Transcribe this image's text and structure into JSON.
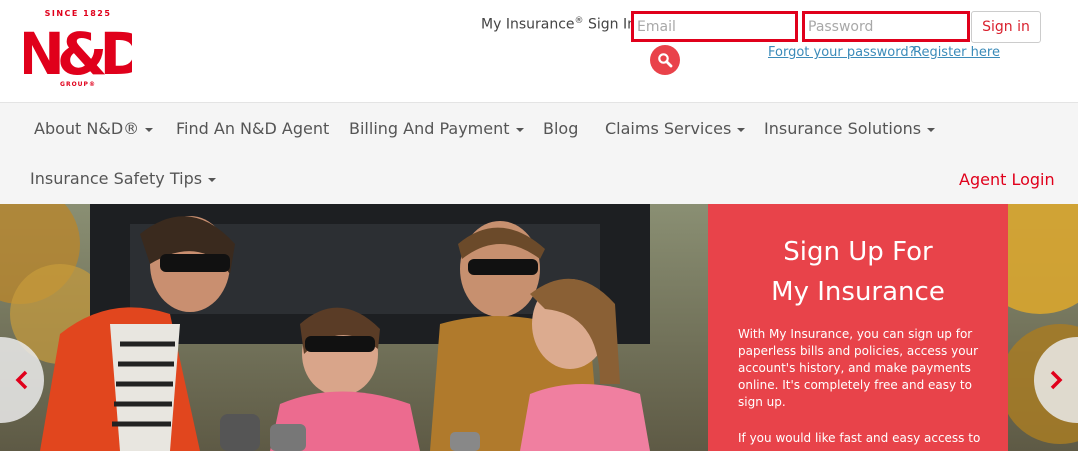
{
  "header": {
    "logo": {
      "tagline_top": "SINCE 1825",
      "monogram": "N&D",
      "tagline_bottom": "GROUP®"
    },
    "signin_label": "My Insurance",
    "signin_label_sup": "®",
    "signin_label_suffix": " Sign In:",
    "email_placeholder": "Email",
    "password_placeholder": "Password",
    "signin_button": "Sign in",
    "forgot_password": "Forgot your password?",
    "register": "Register here",
    "search_icon": "magnifier-icon"
  },
  "nav": {
    "items": [
      {
        "label": "About N&D®",
        "dropdown": true
      },
      {
        "label": "Find An N&D Agent",
        "dropdown": false
      },
      {
        "label": "Billing And Payment",
        "dropdown": true
      },
      {
        "label": "Blog",
        "dropdown": false
      },
      {
        "label": "Claims Services",
        "dropdown": true
      },
      {
        "label": "Insurance Solutions",
        "dropdown": true
      },
      {
        "label": "Insurance Safety Tips",
        "dropdown": true
      }
    ],
    "agent_login": "Agent Login"
  },
  "hero": {
    "promo_title_line1": "Sign Up For",
    "promo_title_line2": "My Insurance",
    "promo_body": "With My Insurance, you can sign up for paperless bills and policies, access your account's history, and make payments online. It's completely free and easy to sign up.",
    "promo_body2": "If you would like fast and easy access to",
    "prev_icon": "chevron-left-icon",
    "next_icon": "chevron-right-icon"
  },
  "colors": {
    "brand_red": "#e0001b",
    "promo_bg": "#e8434a",
    "link_blue": "#3b8bb9",
    "nav_bg": "#f5f5f5"
  }
}
